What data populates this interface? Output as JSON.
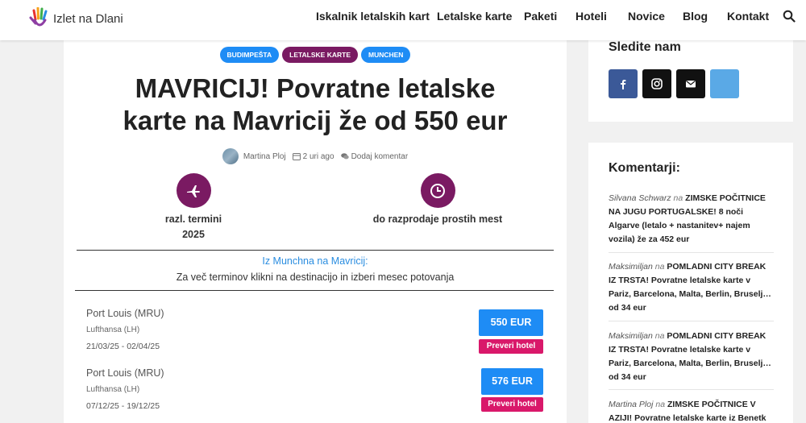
{
  "site": {
    "name": "Izlet na Dlani"
  },
  "nav": {
    "items": [
      "Iskalnik letalskih kart",
      "Letalske karte",
      "Paketi",
      "Hoteli",
      "Novice",
      "Blog",
      "Kontakt"
    ],
    "search_icon": "search-icon"
  },
  "article": {
    "tags": [
      {
        "label": "BUDIMPEŠTA",
        "color": "#1e8cf5"
      },
      {
        "label": "LETALSKE KARTE",
        "color": "#7a1a62"
      },
      {
        "label": "MUNCHEN",
        "color": "#1e8cf5"
      }
    ],
    "title": "MAVRICIJ! Povratne letalske karte na Mavricij že od 550 eur",
    "author": "Martina Ploj",
    "time_ago": "2 uri ago",
    "comment_link": "Dodaj komentar",
    "features": [
      {
        "icon": "airplane-icon",
        "label_line1": "razl. termini",
        "label_line2": "2025"
      },
      {
        "icon": "clock-icon",
        "label_line1": "do razprodaje prostih mest",
        "label_line2": ""
      }
    ],
    "route_title": "Iz Munchna na Mavricij:",
    "route_subtitle": "Za več terminov klikni na destinacijo in izberi mesec potovanja",
    "deals": [
      {
        "destination": "Port Louis (MRU)",
        "airline": "Lufthansa (LH)",
        "dates": "21/03/25 - 02/04/25",
        "price": "550 EUR",
        "hotel_label": "Preveri hotel"
      },
      {
        "destination": "Port Louis (MRU)",
        "airline": "Lufthansa (LH)",
        "dates": "07/12/25 - 19/12/25",
        "price": "576 EUR",
        "hotel_label": "Preveri hotel"
      }
    ]
  },
  "sidebar": {
    "follow_title": "Sledite nam",
    "socials": [
      {
        "icon": "facebook-icon",
        "color": "#3b5998"
      },
      {
        "icon": "instagram-icon",
        "color": "#111111"
      },
      {
        "icon": "mail-icon",
        "color": "#111111"
      },
      {
        "icon": "blank-social-icon",
        "color": "#5aa9e6"
      }
    ],
    "comments_title": "Komentarji:",
    "comments": [
      {
        "author": "Silvana Schwarz",
        "on": "na",
        "post": "ZIMSKE POČITNICE NA JUGU PORTUGALSKE! 8 noči Algarve (letalo + nastanitev+ najem vozila) že za 452 eur"
      },
      {
        "author": "Maksimiljan",
        "on": "na",
        "post": "POMLADNI CITY BREAK IZ TRSTA! Povratne letalske karte v Pariz, Barcelona, Malta, Berlin, Bruselj… od 34 eur"
      },
      {
        "author": "Maksimiljan",
        "on": "na",
        "post": "POMLADNI CITY BREAK IZ TRSTA! Povratne letalske karte v Pariz, Barcelona, Malta, Berlin, Bruselj… od 34 eur"
      },
      {
        "author": "Martina Ploj",
        "on": "na",
        "post": "ZIMSKE POČITNICE V AZIJI! Povratne letalske karte iz Benetk"
      }
    ]
  }
}
